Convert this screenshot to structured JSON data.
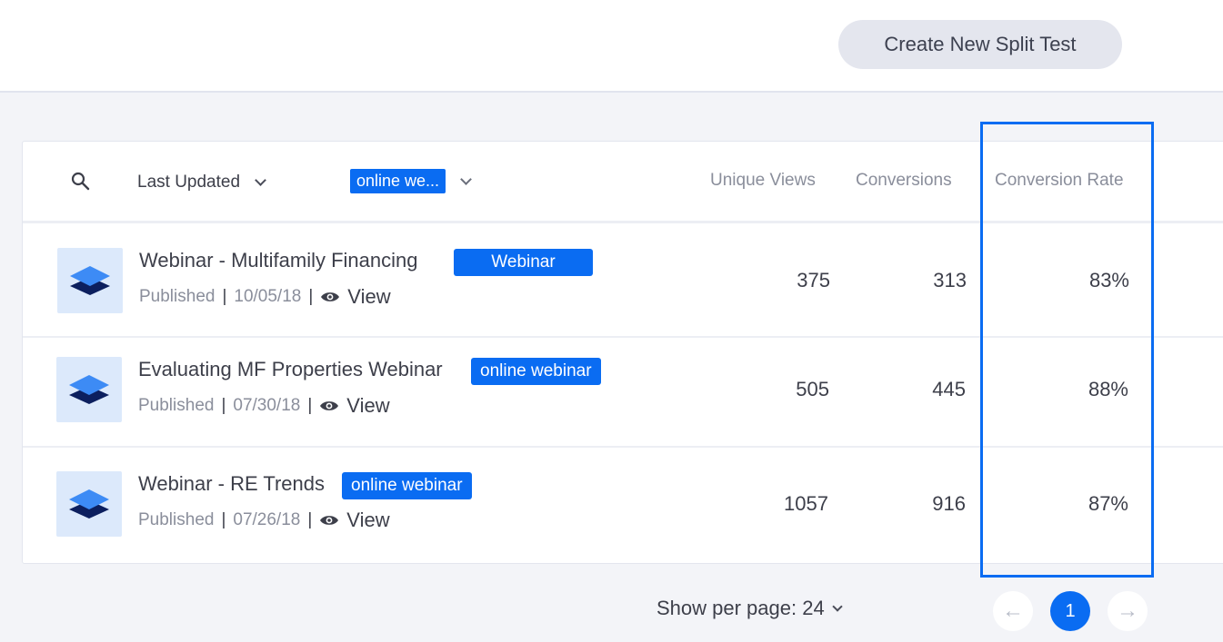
{
  "header": {
    "create_button": "Create New Split Test"
  },
  "filters": {
    "sort_label": "Last Updated",
    "tag_filter": "online we...",
    "columns": {
      "unique_views": "Unique Views",
      "conversions": "Conversions",
      "conversion_rate": "Conversion Rate"
    }
  },
  "rows": [
    {
      "title": "Webinar - Multifamily Financing",
      "badge": "Webinar",
      "status": "Published",
      "date": "10/05/18",
      "view": "View",
      "unique_views": "375",
      "conversions": "313",
      "rate": "83%"
    },
    {
      "title": "Evaluating MF Properties Webinar",
      "badge": "online webinar",
      "status": "Published",
      "date": "07/30/18",
      "view": "View",
      "unique_views": "505",
      "conversions": "445",
      "rate": "88%"
    },
    {
      "title": "Webinar - RE Trends",
      "badge": "online webinar",
      "status": "Published",
      "date": "07/26/18",
      "view": "View",
      "unique_views": "1057",
      "conversions": "916",
      "rate": "87%"
    }
  ],
  "pagination": {
    "per_page_label": "Show per page: 24",
    "current_page": "1",
    "prev_icon": "←",
    "next_icon": "→"
  },
  "colors": {
    "accent": "#0a6cf2",
    "thumb_bg": "#dce9fb"
  }
}
